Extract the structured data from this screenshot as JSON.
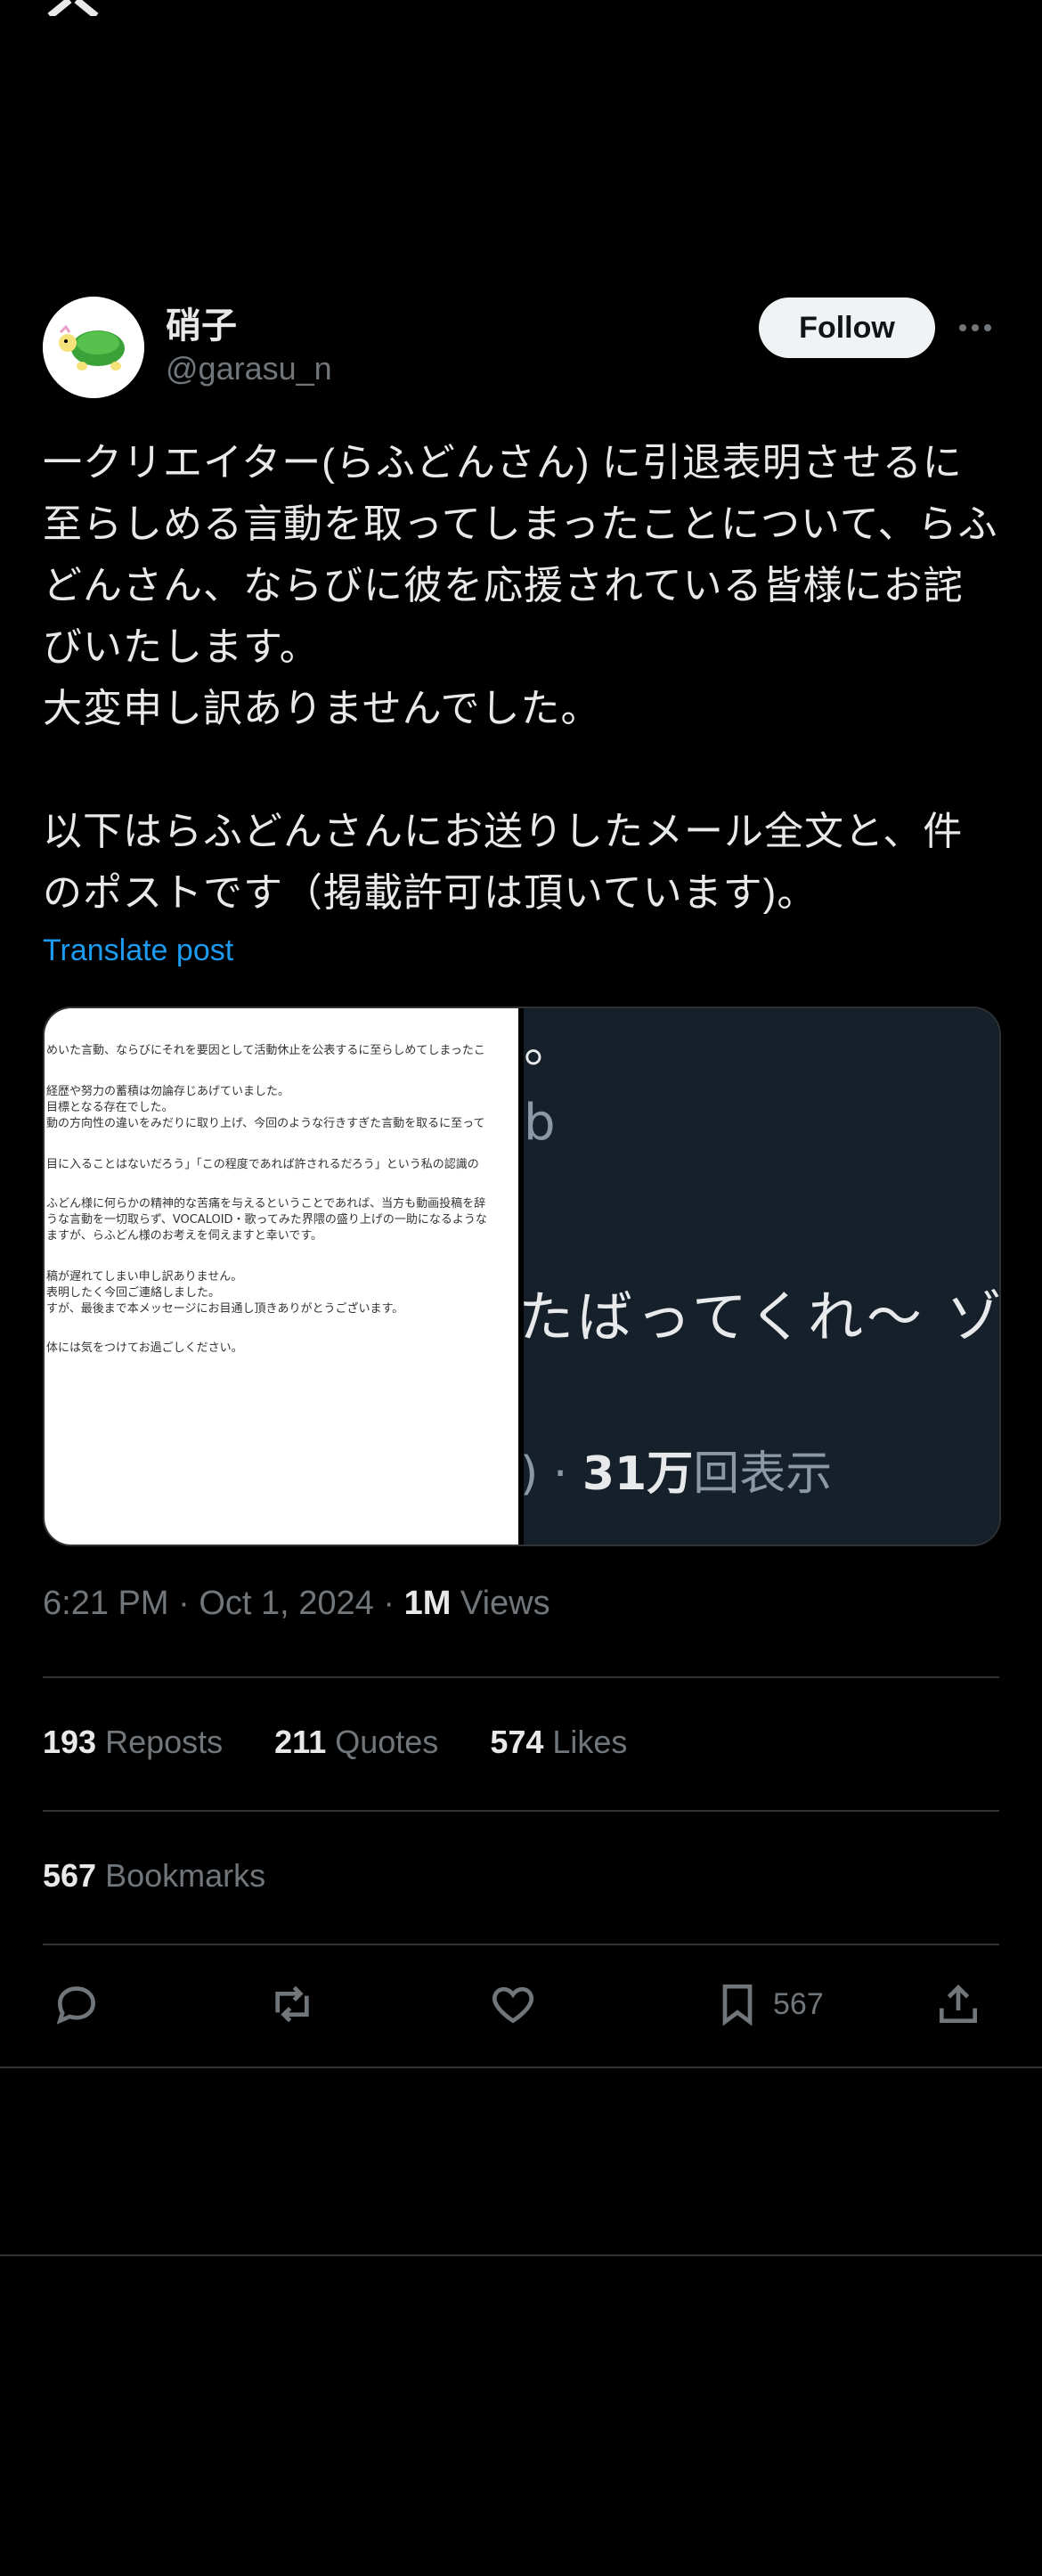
{
  "app": {
    "logo_icon": "x-logo-icon"
  },
  "post": {
    "author": {
      "display_name": "硝子",
      "handle": "@garasu_n",
      "avatar_icon": "turtle-avatar"
    },
    "follow_label": "Follow",
    "more_icon": "more-horizontal-icon",
    "text": "一クリエイター(らふどんさん) に引退表明させるに至らしめる言動を取ってしまったことについて、らふどんさん、ならびに彼を応援されている皆様にお詫びいたします。\n大変申し訳ありませんでした。\n\n以下はらふどんさんにお送りしたメール全文と、件のポストです（掲載許可は頂いています)。",
    "translate_label": "Translate post",
    "media": {
      "left_email_lines": [
        "めいた言動、ならびにそれを要因として活動休止を公表するに至らしめてしまったこ",
        "",
        "経歴や努力の蓄積は勿論存じあげていました。",
        "目標となる存在でした。",
        "動の方向性の違いをみだりに取り上げ、今回のような行きすぎた言動を取るに至って",
        "",
        "目に入ることはないだろう」「この程度であれば許されるだろう」という私の認識の",
        "",
        "ふどん様に何らかの精神的な苦痛を与えるということであれば、当方も動画投稿を辞",
        "うな言動を一切取らず、VOCALOID・歌ってみた界隈の盛り上げの一助になるような",
        "ますが、らふどん様のお考えを伺えますと幸いです。",
        "",
        "稿が遅れてしまい申し訳ありません。",
        "表明したく今回ご連絡しました。",
        "すが、最後まで本メッセージにお目通し頂きありがとうございます。",
        "",
        "体には気をつけてお過ごしください。"
      ],
      "right_text": {
        "line1": "。",
        "line2": "b",
        "line3": "たばってくれ〜 ゾン",
        "views_prefix": ") · ",
        "views_number": "31万",
        "views_suffix": "回表示"
      }
    },
    "timestamp": {
      "time": "6:21 PM",
      "separator": " · ",
      "date": "Oct 1, 2024",
      "views_count": "1M",
      "views_label": "Views"
    },
    "stats": {
      "reposts_count": "193",
      "reposts_label": "Reposts",
      "quotes_count": "211",
      "quotes_label": "Quotes",
      "likes_count": "574",
      "likes_label": "Likes",
      "bookmarks_count": "567",
      "bookmarks_label": "Bookmarks"
    },
    "actions": {
      "reply_icon": "reply-icon",
      "repost_icon": "repost-icon",
      "like_icon": "heart-icon",
      "bookmark_icon": "bookmark-icon",
      "bookmark_count": "567",
      "share_icon": "share-icon"
    }
  }
}
